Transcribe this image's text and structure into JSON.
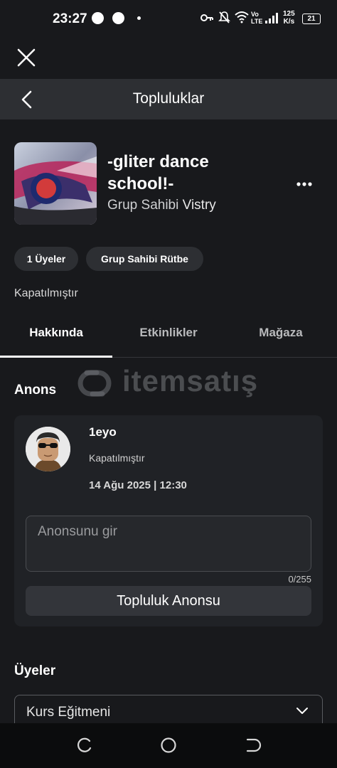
{
  "status_bar": {
    "time": "23:27",
    "network": "Vo LTE",
    "speed_value": "125",
    "speed_unit": "K/s",
    "battery": "21",
    "icons": [
      "key-icon",
      "bell-off-icon",
      "wifi-icon",
      "signal-icon",
      "battery-icon"
    ]
  },
  "header": {
    "title": "Topluluklar"
  },
  "group": {
    "name": "-gliter dance school!-",
    "owner_prefix": "Grup Sahibi",
    "owner_name": "Vistry",
    "members_badge": "1 Üyeler",
    "rank_badge": "Grup Sahibi Rütbe",
    "status": "Kapatılmıştır"
  },
  "tabs": [
    {
      "label": "Hakkında",
      "active": true
    },
    {
      "label": "Etkinlikler",
      "active": false
    },
    {
      "label": "Mağaza",
      "active": false
    }
  ],
  "watermark": {
    "text": "itemsatış"
  },
  "announcement": {
    "section_title": "Anons",
    "poster_name": "1eyo",
    "post_status": "Kapatılmıştır",
    "post_date": "14 Ağu 2025 | 12:30",
    "input_placeholder": "Anonsunu gir",
    "char_count": "0/255",
    "submit_label": "Topluluk Anonsu"
  },
  "members": {
    "section_title": "Üyeler",
    "selected_role": "Kurs Eğitmeni"
  },
  "colors": {
    "background": "#18191c",
    "header_bg": "#2d2f33",
    "card_bg": "#202226",
    "pill_bg": "#2d2f33"
  }
}
